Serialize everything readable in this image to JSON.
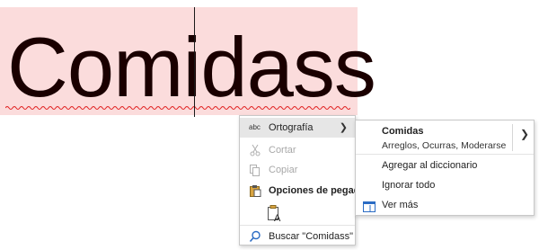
{
  "document": {
    "word": "Comidass"
  },
  "context_menu": {
    "spelling": {
      "label": "Ortografía",
      "icon": "spelling-abc-icon",
      "icon_text": "abc"
    },
    "cut": {
      "label": "Cortar",
      "icon": "scissors-icon"
    },
    "copy": {
      "label": "Copiar",
      "icon": "copy-icon"
    },
    "paste_options": {
      "label": "Opciones de pegado:",
      "icon": "clipboard-icon"
    },
    "paste_keep_text": {
      "icon": "paste-text-only-icon"
    },
    "search": {
      "label": "Buscar \"Comidass\"",
      "icon": "search-icon"
    }
  },
  "spelling_submenu": {
    "suggestion": "Comidas",
    "alternatives": "Arreglos, Ocurras, Moderarse",
    "add_to_dictionary": "Agregar al diccionario",
    "ignore_all": "Ignorar todo",
    "see_more": "Ver más"
  },
  "colors": {
    "word_highlight": "#fbdcdc",
    "squiggle": "#e02020",
    "menu_hover": "#e6e6e6",
    "disabled_text": "#a8a8a8",
    "accent": "#2b6cc4"
  }
}
